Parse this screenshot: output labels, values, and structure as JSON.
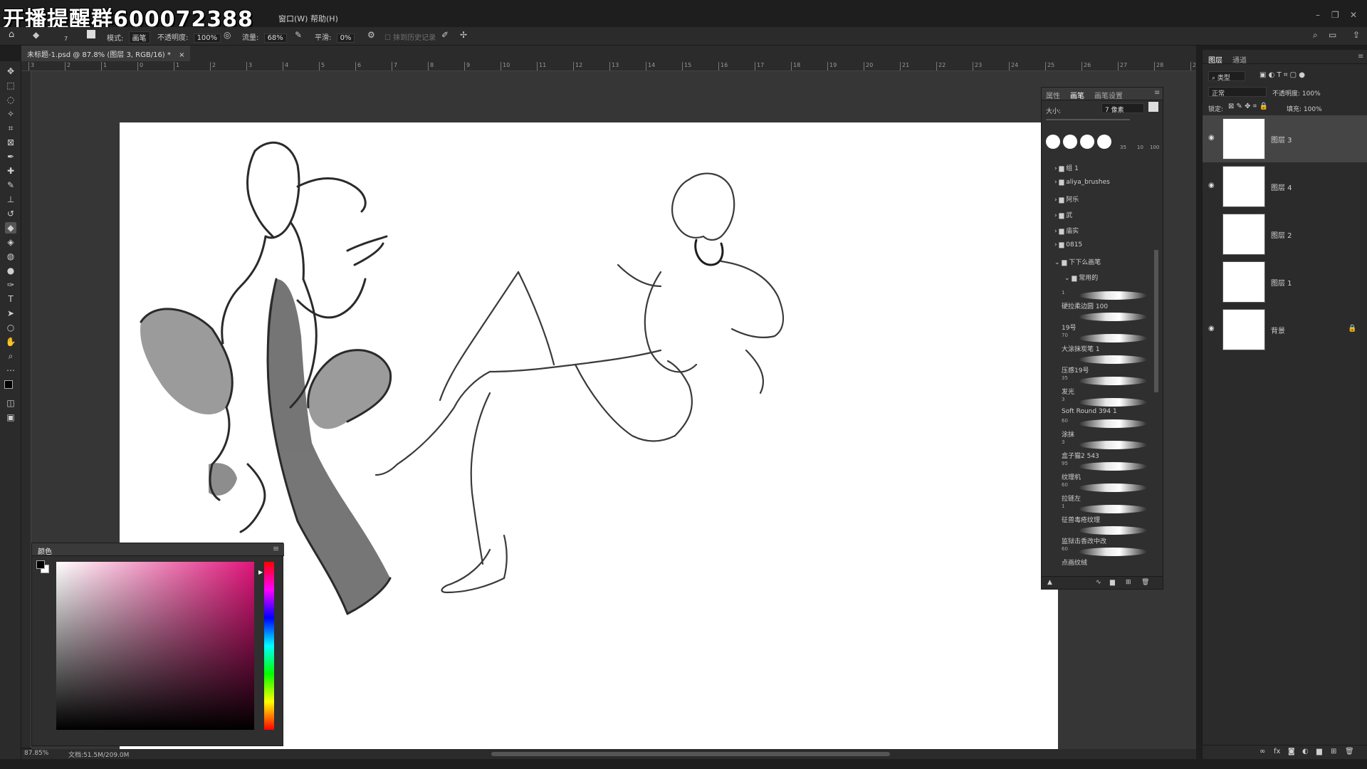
{
  "watermark": "开播提醒群600072388",
  "menu": {
    "items": [
      "窗口(W)",
      "帮助(H)"
    ]
  },
  "options": {
    "mode_label": "模式:",
    "mode_value": "画笔",
    "opacity_label": "不透明度:",
    "opacity_value": "100%",
    "flow_label": "流量:",
    "flow_value": "68%",
    "smooth_label": "平滑:",
    "smooth_value": "0%",
    "history_label": "抹到历史记录",
    "brush_size_small": "7"
  },
  "document": {
    "tab_title": "未标题-1.psd @ 87.8% (图层 3, RGB/16) *",
    "close_glyph": "×"
  },
  "ruler": {
    "ticks": [
      "3",
      "2",
      "1",
      "0",
      "1",
      "2",
      "3",
      "4",
      "5",
      "6",
      "7",
      "8",
      "9",
      "10",
      "11",
      "12",
      "13",
      "14",
      "15",
      "16",
      "17",
      "18",
      "19",
      "20",
      "21",
      "22",
      "23",
      "24",
      "25",
      "26",
      "27",
      "28",
      "29"
    ]
  },
  "status": {
    "zoom": "87.85%",
    "doc_info": "文档:51.5M/209.0M"
  },
  "color_panel": {
    "title": "颜色",
    "picker_colors": {
      "hue": "#e0157a",
      "fg": "#000000",
      "bg": "#ffffff"
    }
  },
  "brush_panel": {
    "tabs": [
      "属性",
      "画笔",
      "画笔设置"
    ],
    "size_label": "大小:",
    "size_value": "7 像素",
    "preset_numbers": [
      "35",
      "10",
      "100"
    ],
    "folders": [
      "组 1",
      "aliya_brushes",
      "阿乐",
      "武",
      "庙实",
      "0815",
      "下下么画笔"
    ],
    "subfolder": "常用的",
    "brushes": [
      {
        "size": "1",
        "name": "硬拉柔边圆 100"
      },
      {
        "size": "",
        "name": "19号"
      },
      {
        "size": "70",
        "name": "大涂抹炭笔 1"
      },
      {
        "size": "",
        "name": "压感19号"
      },
      {
        "size": "35",
        "name": "发光"
      },
      {
        "size": "3",
        "name": "Soft Round 394 1"
      },
      {
        "size": "60",
        "name": "涂抹"
      },
      {
        "size": "3",
        "name": "盒子猫2 543"
      },
      {
        "size": "95",
        "name": "纹理机"
      },
      {
        "size": "60",
        "name": "拉链左"
      },
      {
        "size": "1",
        "name": "征兽毒疮纹理"
      },
      {
        "size": "",
        "name": "监狱击香改中改"
      },
      {
        "size": "60",
        "name": "点画纹绒"
      }
    ]
  },
  "layers_panel": {
    "tabs": [
      "图层",
      "通道"
    ],
    "filter_label": "类型",
    "blend_mode": "正常",
    "opacity_label": "不透明度:",
    "opacity_value": "100%",
    "lock_label": "锁定:",
    "fill_label": "填充:",
    "fill_value": "100%",
    "layers": [
      {
        "name": "图层 3",
        "visible": true,
        "selected": true
      },
      {
        "name": "图层 4",
        "visible": true,
        "selected": false
      },
      {
        "name": "图层 2",
        "visible": false,
        "selected": false
      },
      {
        "name": "图层 1",
        "visible": false,
        "selected": false
      },
      {
        "name": "背景",
        "visible": true,
        "selected": false,
        "locked": true
      }
    ],
    "footer_fx": "fx"
  }
}
